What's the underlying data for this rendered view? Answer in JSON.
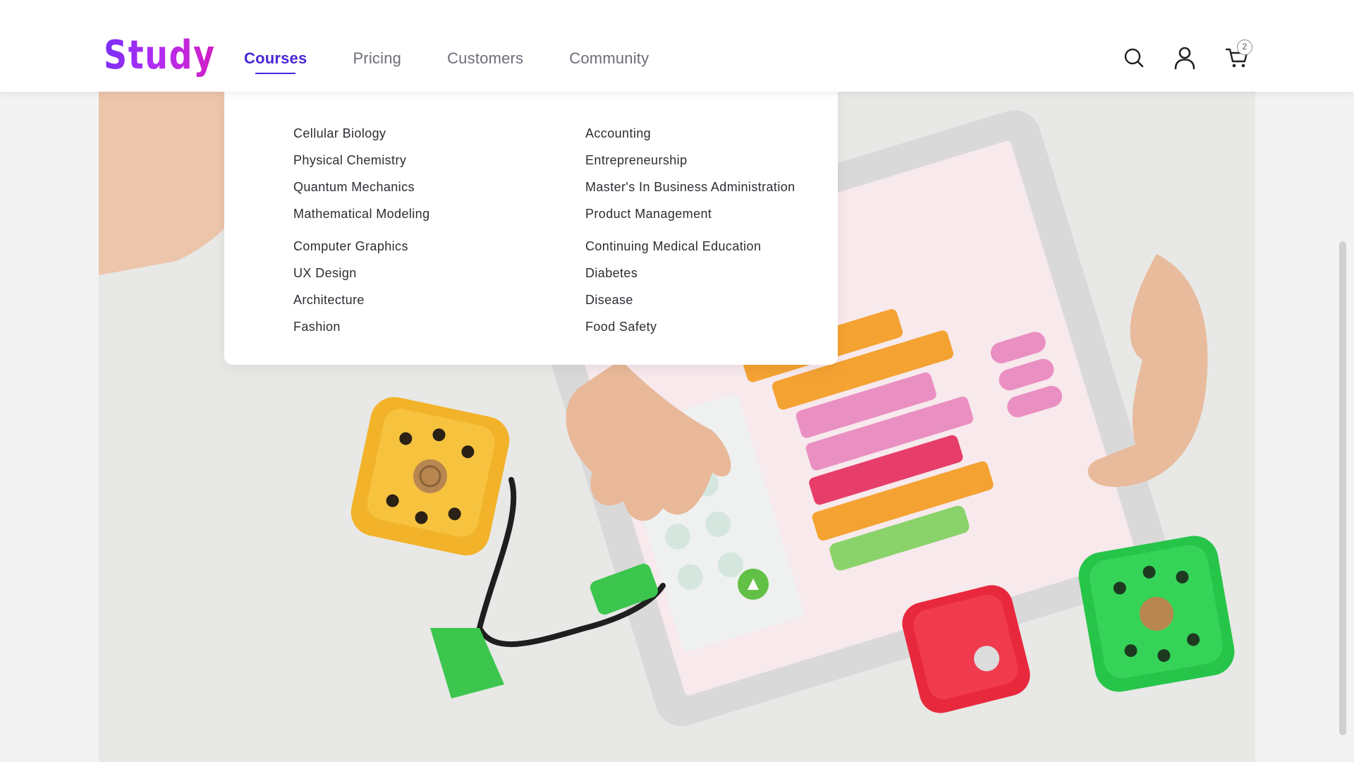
{
  "brand": {
    "logo_text": "Study",
    "accent_color": "#4a26d6",
    "logo_gradient": [
      "#7b2ff7",
      "#d11fc2"
    ]
  },
  "nav": {
    "items": [
      {
        "label": "Courses",
        "active": true
      },
      {
        "label": "Pricing",
        "active": false
      },
      {
        "label": "Customers",
        "active": false
      },
      {
        "label": "Community",
        "active": false
      }
    ]
  },
  "header_actions": {
    "search_icon": "search-icon",
    "account_icon": "user-icon",
    "cart_icon": "cart-icon",
    "cart_count": "2"
  },
  "courses_menu": {
    "columns": [
      {
        "groups": [
          [
            "Cellular Biology",
            "Physical Chemistry",
            "Quantum Mechanics",
            "Mathematical Modeling"
          ],
          [
            "Computer Graphics",
            "UX Design",
            "Architecture",
            "Fashion"
          ]
        ]
      },
      {
        "groups": [
          [
            "Accounting",
            "Entrepreneurship",
            "Master's In Business Administration",
            "Product Management"
          ],
          [
            "Continuing Medical Education",
            "Diabetes",
            "Disease",
            "Food Safety"
          ]
        ]
      }
    ]
  },
  "hero_image": {
    "subject": "photo"
  }
}
